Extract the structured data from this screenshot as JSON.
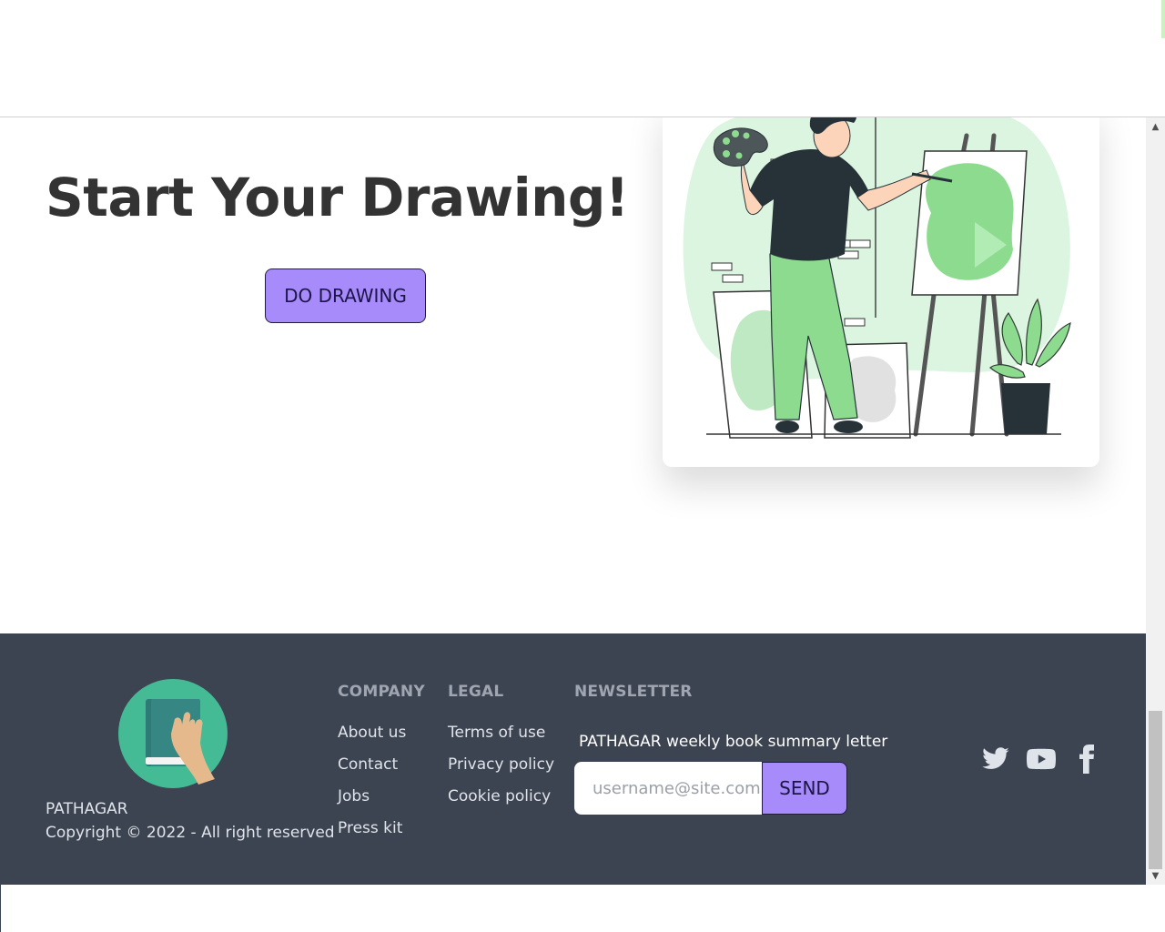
{
  "hero": {
    "title": "Start Your Drawing!",
    "button_label": "DO DRAWING"
  },
  "footer": {
    "brand": "PATHAGAR",
    "copyright": "Copyright © 2022 - All right reserved",
    "company": {
      "title": "COMPANY",
      "links": [
        "About us",
        "Contact",
        "Jobs",
        "Press kit"
      ]
    },
    "legal": {
      "title": "LEGAL",
      "links": [
        "Terms of use",
        "Privacy policy",
        "Cookie policy"
      ]
    },
    "newsletter": {
      "title": "NEWSLETTER",
      "label": "PATHAGAR weekly book summary letter",
      "placeholder": "username@site.com",
      "button_label": "SEND"
    },
    "social": [
      "twitter-icon",
      "youtube-icon",
      "facebook-icon"
    ]
  },
  "colors": {
    "accent": "#a78bfa",
    "footer_bg": "#3d4451",
    "illustration_green": "#8ddb8f"
  }
}
